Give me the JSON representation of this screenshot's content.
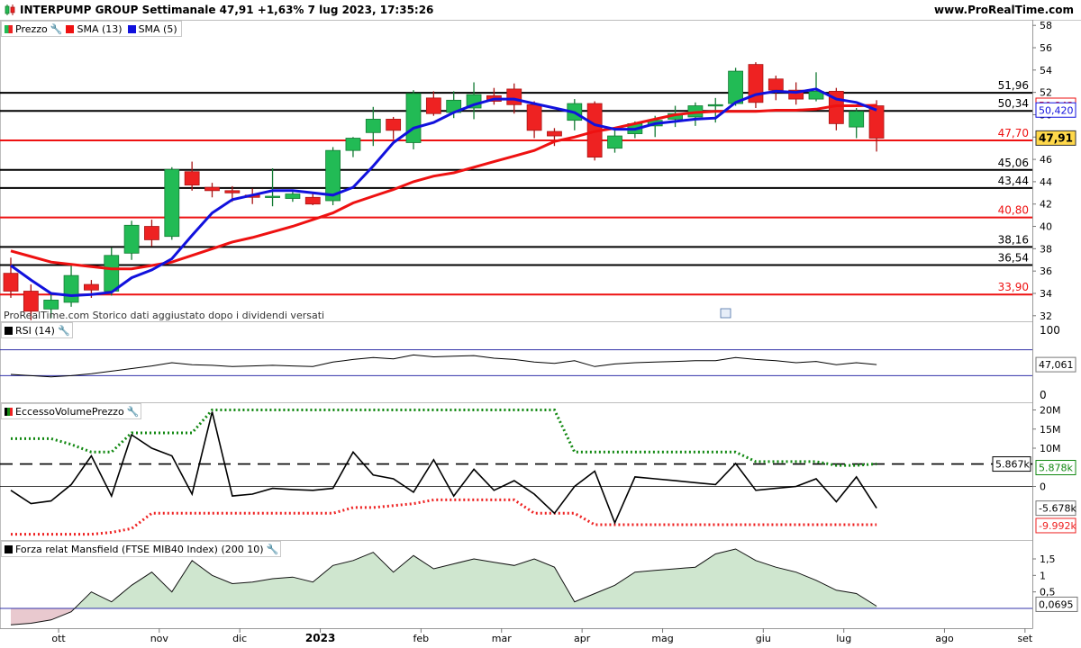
{
  "header": {
    "title": "INTERPUMP GROUP Settimanale 47,91 +1,63% 7 lug 2023, 17:35:26",
    "site": "www.ProRealTime.com"
  },
  "colors": {
    "bull": "#22bb55",
    "bear": "#ee2222",
    "sma13": "#ee1111",
    "sma5": "#1111dd",
    "rsi": "#000000",
    "band_upper": "#118811",
    "band_lower": "#ee2222",
    "mansfield_fill": "#cfe6cf"
  },
  "panels": {
    "price": {
      "tags": [
        {
          "id": "prezzo",
          "label": "Prezzo",
          "icon": "bull-bear-icon"
        },
        {
          "id": "sma13",
          "label": "SMA (13)",
          "color": "#ee1111"
        },
        {
          "id": "sma5",
          "label": "SMA (5)",
          "color": "#1111dd"
        }
      ],
      "footnote": "ProRealTime.com  Storico dati aggiustato dopo i dividendi versati",
      "y_ticks": [
        "58",
        "56",
        "54",
        "52",
        "50",
        "48",
        "46",
        "44",
        "42",
        "40",
        "38",
        "36",
        "34",
        "32"
      ],
      "levels": [
        {
          "value": 51.96,
          "label": "51,96",
          "color": "#000000"
        },
        {
          "value": 50.34,
          "label": "50,34",
          "color": "#000000"
        },
        {
          "value": 47.7,
          "label": "47,70",
          "color": "#ee1111"
        },
        {
          "value": 45.06,
          "label": "45,06",
          "color": "#000000"
        },
        {
          "value": 43.44,
          "label": "43,44",
          "color": "#000000"
        },
        {
          "value": 40.8,
          "label": "40,80",
          "color": "#ee1111"
        },
        {
          "value": 38.16,
          "label": "38,16",
          "color": "#000000"
        },
        {
          "value": 36.54,
          "label": "36,54",
          "color": "#000000"
        },
        {
          "value": 33.9,
          "label": "33,90",
          "color": "#ee1111"
        }
      ],
      "badges": [
        {
          "value": 50.843,
          "label": "50,843",
          "type": "sma13"
        },
        {
          "value": 50.42,
          "label": "50,420",
          "type": "sma5"
        },
        {
          "value": 47.91,
          "label": "47,91",
          "type": "price"
        }
      ]
    },
    "rsi": {
      "tag": "RSI (14)",
      "y_ticks": [
        "100",
        "0"
      ],
      "current_label": "47,061"
    },
    "evp": {
      "tag": "EccessoVolumePrezzo",
      "y_ticks": [
        "20M",
        "15M",
        "10M",
        "0"
      ],
      "badges": [
        {
          "value": 5.867,
          "label": "5.867k",
          "type": "ref"
        },
        {
          "value": 5.878,
          "label": "5.878k",
          "type": "upper"
        },
        {
          "value": -5.678,
          "label": "-5.678k",
          "type": "main"
        },
        {
          "value": -9.992,
          "label": "-9.992k",
          "type": "lower"
        }
      ]
    },
    "mansfield": {
      "tag": "Forza relat Mansfield (FTSE MIB40 Index) (200 10)",
      "y_ticks": [
        "1,5",
        "1",
        "0,5"
      ],
      "current_label": "0,0695"
    }
  },
  "x_axis": {
    "labels": [
      {
        "week": 3,
        "text": "ott"
      },
      {
        "week": 8,
        "text": "nov"
      },
      {
        "week": 12,
        "text": "dic"
      },
      {
        "week": 16,
        "text": "2023",
        "bold": true
      },
      {
        "week": 21,
        "text": "feb"
      },
      {
        "week": 25,
        "text": "mar"
      },
      {
        "week": 29,
        "text": "apr"
      },
      {
        "week": 33,
        "text": "mag"
      },
      {
        "week": 38,
        "text": "giu"
      },
      {
        "week": 42,
        "text": "lug"
      },
      {
        "week": 47,
        "text": "ago"
      },
      {
        "week": 51,
        "text": "set"
      }
    ]
  },
  "chart_data": {
    "type": "candlestick",
    "timeframe": "weekly",
    "price_ylim": [
      31.5,
      58.5
    ],
    "candles": [
      {
        "o": 35.8,
        "h": 37.2,
        "l": 33.6,
        "c": 34.2
      },
      {
        "o": 34.2,
        "h": 34.8,
        "l": 31.6,
        "c": 32.4
      },
      {
        "o": 32.6,
        "h": 34.0,
        "l": 31.8,
        "c": 33.4
      },
      {
        "o": 33.2,
        "h": 36.7,
        "l": 32.8,
        "c": 35.6
      },
      {
        "o": 34.8,
        "h": 35.2,
        "l": 33.6,
        "c": 34.3
      },
      {
        "o": 34.2,
        "h": 38.1,
        "l": 33.8,
        "c": 37.4
      },
      {
        "o": 37.6,
        "h": 40.5,
        "l": 37.0,
        "c": 40.1
      },
      {
        "o": 40.0,
        "h": 40.6,
        "l": 38.2,
        "c": 38.8
      },
      {
        "o": 39.1,
        "h": 45.3,
        "l": 38.8,
        "c": 45.1
      },
      {
        "o": 44.9,
        "h": 45.8,
        "l": 43.2,
        "c": 43.7
      },
      {
        "o": 43.5,
        "h": 43.9,
        "l": 42.6,
        "c": 43.2
      },
      {
        "o": 43.2,
        "h": 43.6,
        "l": 42.2,
        "c": 43.0
      },
      {
        "o": 42.8,
        "h": 43.4,
        "l": 42.0,
        "c": 42.6
      },
      {
        "o": 42.6,
        "h": 45.2,
        "l": 41.8,
        "c": 42.7
      },
      {
        "o": 42.5,
        "h": 43.1,
        "l": 42.2,
        "c": 42.9
      },
      {
        "o": 42.6,
        "h": 43.0,
        "l": 41.9,
        "c": 42.0
      },
      {
        "o": 42.3,
        "h": 47.1,
        "l": 41.9,
        "c": 46.8
      },
      {
        "o": 46.8,
        "h": 48.0,
        "l": 46.2,
        "c": 47.9
      },
      {
        "o": 48.4,
        "h": 50.7,
        "l": 47.2,
        "c": 49.6
      },
      {
        "o": 49.6,
        "h": 49.8,
        "l": 47.8,
        "c": 48.6
      },
      {
        "o": 47.5,
        "h": 52.2,
        "l": 46.9,
        "c": 51.9
      },
      {
        "o": 51.5,
        "h": 52.1,
        "l": 49.9,
        "c": 50.1
      },
      {
        "o": 50.2,
        "h": 52.1,
        "l": 49.7,
        "c": 51.3
      },
      {
        "o": 50.6,
        "h": 52.9,
        "l": 49.6,
        "c": 51.8
      },
      {
        "o": 51.7,
        "h": 52.4,
        "l": 50.9,
        "c": 51.2
      },
      {
        "o": 52.3,
        "h": 52.8,
        "l": 50.1,
        "c": 50.9
      },
      {
        "o": 50.9,
        "h": 51.2,
        "l": 47.9,
        "c": 48.6
      },
      {
        "o": 48.5,
        "h": 48.8,
        "l": 47.2,
        "c": 48.1
      },
      {
        "o": 49.5,
        "h": 51.4,
        "l": 48.6,
        "c": 51.0
      },
      {
        "o": 51.0,
        "h": 51.2,
        "l": 45.9,
        "c": 46.2
      },
      {
        "o": 47.0,
        "h": 48.6,
        "l": 46.6,
        "c": 48.1
      },
      {
        "o": 48.3,
        "h": 49.4,
        "l": 47.9,
        "c": 49.2
      },
      {
        "o": 49.0,
        "h": 49.9,
        "l": 48.0,
        "c": 49.5
      },
      {
        "o": 49.6,
        "h": 50.8,
        "l": 48.9,
        "c": 50.1
      },
      {
        "o": 49.8,
        "h": 51.1,
        "l": 49.0,
        "c": 50.8
      },
      {
        "o": 50.9,
        "h": 51.5,
        "l": 49.3,
        "c": 50.9
      },
      {
        "o": 51.0,
        "h": 54.2,
        "l": 50.8,
        "c": 53.9
      },
      {
        "o": 54.5,
        "h": 54.7,
        "l": 50.6,
        "c": 51.1
      },
      {
        "o": 53.2,
        "h": 53.5,
        "l": 51.3,
        "c": 52.2
      },
      {
        "o": 52.2,
        "h": 52.9,
        "l": 50.9,
        "c": 51.4
      },
      {
        "o": 51.4,
        "h": 53.8,
        "l": 51.2,
        "c": 52.1
      },
      {
        "o": 52.1,
        "h": 52.4,
        "l": 48.6,
        "c": 49.2
      },
      {
        "o": 48.9,
        "h": 50.6,
        "l": 47.9,
        "c": 50.3
      },
      {
        "o": 50.8,
        "h": 51.3,
        "l": 46.7,
        "c": 47.9
      }
    ],
    "sma13": [
      37.8,
      37.3,
      36.8,
      36.6,
      36.4,
      36.2,
      36.2,
      36.5,
      36.8,
      37.4,
      38.0,
      38.6,
      39.0,
      39.5,
      40.0,
      40.6,
      41.2,
      42.1,
      42.7,
      43.3,
      44.0,
      44.5,
      44.8,
      45.3,
      45.8,
      46.3,
      46.8,
      47.6,
      48.0,
      48.5,
      48.8,
      49.2,
      49.6,
      50.0,
      50.2,
      50.3,
      50.3,
      50.3,
      50.4,
      50.4,
      50.5,
      50.8,
      50.8,
      50.84
    ],
    "sma5": [
      36.5,
      35.2,
      34.0,
      33.8,
      33.9,
      34.1,
      35.4,
      36.1,
      37.1,
      39.2,
      41.2,
      42.4,
      42.8,
      43.2,
      43.2,
      43.0,
      42.8,
      43.5,
      45.4,
      47.5,
      48.8,
      49.3,
      50.2,
      50.9,
      51.4,
      51.4,
      51.0,
      50.6,
      50.2,
      49.1,
      48.7,
      48.7,
      49.2,
      49.4,
      49.6,
      49.7,
      51.1,
      51.8,
      52.1,
      52.0,
      52.3,
      51.4,
      51.1,
      50.42
    ],
    "rsi": {
      "ylim": [
        0,
        100
      ],
      "bands": [
        70,
        30
      ],
      "values": [
        32,
        30,
        28,
        30,
        33,
        37,
        41,
        45,
        50,
        47,
        46,
        44,
        45,
        46,
        45,
        44,
        51,
        55,
        58,
        56,
        62,
        59,
        60,
        61,
        57,
        55,
        51,
        49,
        53,
        44,
        48,
        50,
        51,
        52,
        53,
        53,
        58,
        55,
        53,
        50,
        52,
        47,
        50,
        47.061
      ]
    },
    "eccesso_volume_prezzo": {
      "ylim": [
        -14,
        22
      ],
      "reference": 5.867,
      "main": [
        -1,
        -4.5,
        -3.8,
        0.5,
        8,
        -2.5,
        13.5,
        10,
        8,
        -2,
        19.5,
        -2.5,
        -2,
        -0.5,
        -0.8,
        -1,
        -0.5,
        9,
        3,
        2,
        -1.5,
        7,
        -2.5,
        4.5,
        -1,
        1.5,
        -2,
        -7,
        0,
        4,
        -9.5,
        2.5,
        2,
        1.5,
        1,
        0.5,
        6,
        -1,
        -0.5,
        0,
        2,
        -4,
        2.5,
        -5.678
      ],
      "upper": [
        12.5,
        12.5,
        12.5,
        11,
        9,
        9,
        14,
        14,
        14,
        14,
        20,
        20,
        20,
        20,
        20,
        20,
        20,
        20,
        20,
        20,
        20,
        20,
        20,
        20,
        20,
        20,
        20,
        20,
        9,
        9,
        9,
        9,
        9,
        9,
        9,
        9,
        9,
        6.5,
        6.5,
        6.5,
        6.5,
        5.5,
        5.5,
        5.878
      ],
      "lower": [
        -12.5,
        -12.5,
        -12.5,
        -12.5,
        -12.5,
        -12,
        -11,
        -7,
        -7,
        -7,
        -7,
        -7,
        -7,
        -7,
        -7,
        -7,
        -7,
        -5.5,
        -5.5,
        -5,
        -4.5,
        -3.5,
        -3.5,
        -3.5,
        -3.5,
        -3.5,
        -7,
        -7,
        -7,
        -9.992,
        -9.992,
        -9.992,
        -9.992,
        -9.992,
        -9.992,
        -9.992,
        -9.992,
        -9.992,
        -9.992,
        -9.992,
        -9.992,
        -9.992,
        -9.992,
        -9.992
      ]
    },
    "mansfield": {
      "ylim": [
        -0.6,
        1.8
      ],
      "values": [
        -0.5,
        -0.45,
        -0.35,
        -0.1,
        0.5,
        0.2,
        0.7,
        1.1,
        0.5,
        1.45,
        1.0,
        0.75,
        0.8,
        0.9,
        0.95,
        0.8,
        1.3,
        1.45,
        1.7,
        1.1,
        1.6,
        1.2,
        1.35,
        1.5,
        1.4,
        1.3,
        1.5,
        1.25,
        0.2,
        0.45,
        0.7,
        1.1,
        1.15,
        1.2,
        1.25,
        1.65,
        1.8,
        1.45,
        1.25,
        1.1,
        0.85,
        0.55,
        0.45,
        0.0695
      ]
    }
  }
}
